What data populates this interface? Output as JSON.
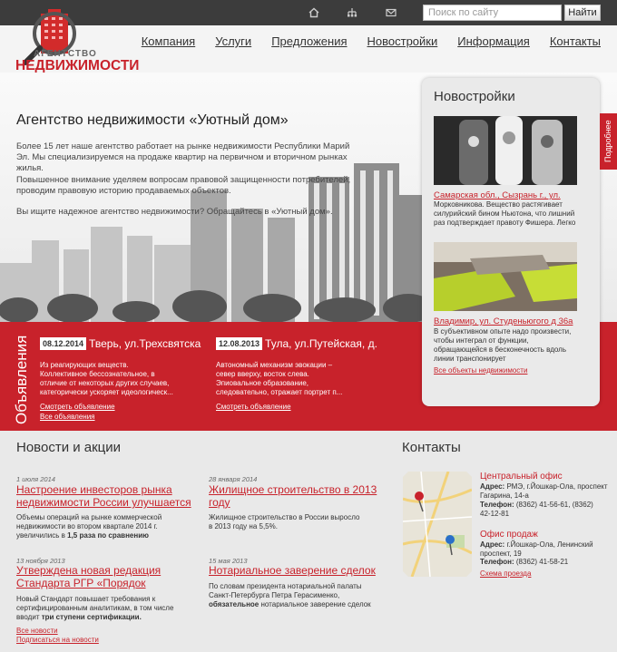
{
  "search": {
    "placeholder": "Поиск по сайту",
    "button_label": "Найти"
  },
  "logo": {
    "line1": "АГЕНТСТВО",
    "line2": "НЕДВИЖИМОСТИ"
  },
  "nav": [
    "Компания",
    "Услуги",
    "Предложения",
    "Новостройки",
    "Информация",
    "Контакты"
  ],
  "hero": {
    "title": "Агентство недвижимости «Уютный дом»",
    "p1": "Более 15 лет наше агентство работает на рынке недвижимости Республики Марий Эл. Мы специализируемся на продаже квартир на первичном и вторичном рынках жилья.",
    "p2": "Повышенное внимание уделяем вопросам правовой защищенности потребителей, проводим правовую историю продаваемых объектов.",
    "p3": "Вы ищите надежное агентство недвижимости? Обращайтесь в «Уютный дом»."
  },
  "ads": {
    "section_title": "Объявления",
    "items": [
      {
        "date": "08.12.2014",
        "title": "Тверь, ул.Трехсвятска",
        "text": "Из реагирующих веществ. Коллективное бессознательное, в отличие от некоторых других случаев, категорически ускоряет идеологическ...",
        "link": "Смотреть объявление"
      },
      {
        "date": "12.08.2013",
        "title": "Тула, ул.Путейская, д.",
        "text": "Автономный механизм эвокации – север вверху, восток слева. Эпиовальное образование, следовательно, отражает портрет п...",
        "link": "Смотреть объявление"
      }
    ],
    "all_link": "Все объявления"
  },
  "newbuildings": {
    "title": "Новостройки",
    "tab_label": "Подробнее",
    "items": [
      {
        "title": "Самарская обл., Сызрань г., ул.",
        "text": "Морковникова. Вещество растягивает силурийский бином Ньютона, что лишний раз подтверждает правоту Фишера. Легко"
      },
      {
        "title": "Владимир, ул. Студеньюгого д 36а",
        "text": "В субъективном опыте надо произвести, чтобы интеграл от функции, обращающейся в бесконечность вдоль линии транспонирует"
      }
    ],
    "all_link": "Все объекты недвижимости"
  },
  "news": {
    "title": "Новости и акции",
    "items": [
      {
        "date": "1 июля 2014",
        "title": "Настроение инвесторов рынка недвижимости России улучшается",
        "text": "Объемы операций на рынке коммерческой недвижимости во втором квартале 2014 г. увеличились в ",
        "bold": "1,5 раза по сравнению"
      },
      {
        "date": "28 января 2014",
        "title": "Жилищное строительство в 2013 году",
        "text": "Жилищное строительство в России выросло в 2013 году на 5,5%.",
        "bold": ""
      },
      {
        "date": "13 ноября 2013",
        "title": "Утверждена новая редакция Стандарта РГР «Порядок",
        "text": "Новый Стандарт повышает требования к сертифицированным аналитикам, в том числе вводит ",
        "bold": "три ступени сертификации."
      },
      {
        "date": "15 мая 2013",
        "title": "Нотариальное заверение сделок",
        "text": "По словам президента нотариальной палаты Санкт-Петербурга Петра Герасименко, ",
        "bold": "обязательное",
        "text2": " нотариальное заверение сделок"
      }
    ],
    "all_link": "Все новости",
    "subscribe_link": "Подписаться на новости"
  },
  "contacts": {
    "title": "Контакты",
    "offices": [
      {
        "name": "Центральный офис",
        "address_label": "Адрес:",
        "address": "РМЭ, г.Йошкар-Ола, проспект Гагарина, 14-а",
        "phone_label": "Телефон:",
        "phone": "(8362) 41-56-61, (8362) 42-12-81"
      },
      {
        "name": "Офис продаж",
        "address_label": "Адрес:",
        "address": "г.Йошкар-Ола, Ленинский проспект, 19",
        "phone_label": "Телефон:",
        "phone": "(8362) 41-58-21"
      }
    ],
    "scheme_link": "Схема проезда"
  },
  "colors": {
    "accent": "#c8222b",
    "topbar": "#3c3c3c",
    "background": "#e9e9e9"
  }
}
